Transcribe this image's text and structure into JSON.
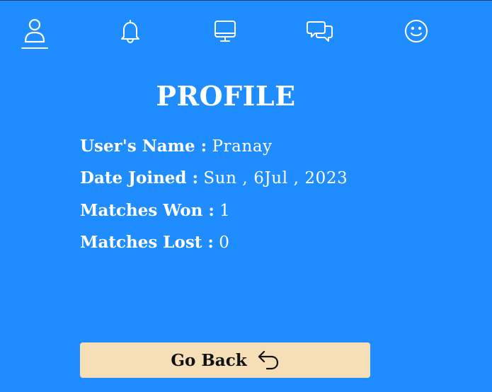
{
  "nav": {
    "items": [
      {
        "icon": "user-icon",
        "active": true
      },
      {
        "icon": "bell-icon",
        "active": false
      },
      {
        "icon": "monitor-icon",
        "active": false
      },
      {
        "icon": "chat-icon",
        "active": false
      },
      {
        "icon": "smiley-icon",
        "active": false
      }
    ]
  },
  "profile": {
    "title": "PROFILE",
    "username_label": "User's Name :",
    "username_value": "Pranay",
    "date_label": "Date Joined :",
    "date_value": "Sun , 6Jul , 2023",
    "won_label": "Matches Won :",
    "won_value": "1",
    "lost_label": "Matches Lost :",
    "lost_value": "0"
  },
  "actions": {
    "go_back_label": "Go Back",
    "go_back_icon": "undo-arrow-icon"
  },
  "colors": {
    "background": "#1f8dff",
    "button_background": "#f6deb6",
    "text": "#ffffff",
    "button_text": "#111111"
  }
}
